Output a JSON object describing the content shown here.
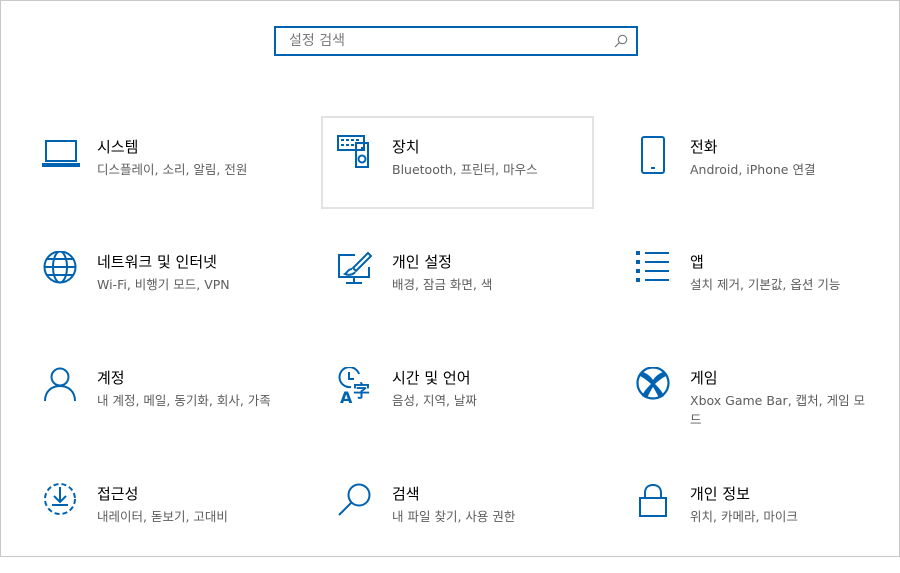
{
  "search": {
    "placeholder": "설정 검색",
    "value": ""
  },
  "accent_color": "#0063b1",
  "tiles": [
    {
      "id": "system",
      "title": "시스템",
      "desc": "디스플레이, 소리, 알림, 전원",
      "icon": "laptop-icon"
    },
    {
      "id": "devices",
      "title": "장치",
      "desc": "Bluetooth, 프린터, 마우스",
      "icon": "keyboard-speaker-icon"
    },
    {
      "id": "phone",
      "title": "전화",
      "desc": "Android, iPhone 연결",
      "icon": "phone-icon"
    },
    {
      "id": "network",
      "title": "네트워크 및 인터넷",
      "desc": "Wi-Fi, 비행기 모드, VPN",
      "icon": "globe-icon"
    },
    {
      "id": "personalization",
      "title": "개인 설정",
      "desc": "배경, 잠금 화면, 색",
      "icon": "paint-monitor-icon"
    },
    {
      "id": "apps",
      "title": "앱",
      "desc": "설치 제거, 기본값, 옵션 기능",
      "icon": "list-icon"
    },
    {
      "id": "accounts",
      "title": "계정",
      "desc": "내 계정, 메일, 동기화, 회사, 가족",
      "icon": "person-icon"
    },
    {
      "id": "time-language",
      "title": "시간 및 언어",
      "desc": "음성, 지역, 날짜",
      "icon": "clock-language-icon"
    },
    {
      "id": "gaming",
      "title": "게임",
      "desc": "Xbox Game Bar, 캡처, 게임 모드",
      "icon": "xbox-icon"
    },
    {
      "id": "ease-of-access",
      "title": "접근성",
      "desc": "내레이터, 돋보기, 고대비",
      "icon": "ease-of-access-icon"
    },
    {
      "id": "search",
      "title": "검색",
      "desc": "내 파일 찾기, 사용 권한",
      "icon": "magnifier-icon"
    },
    {
      "id": "privacy",
      "title": "개인 정보",
      "desc": "위치, 카메라, 마이크",
      "icon": "lock-icon"
    }
  ]
}
